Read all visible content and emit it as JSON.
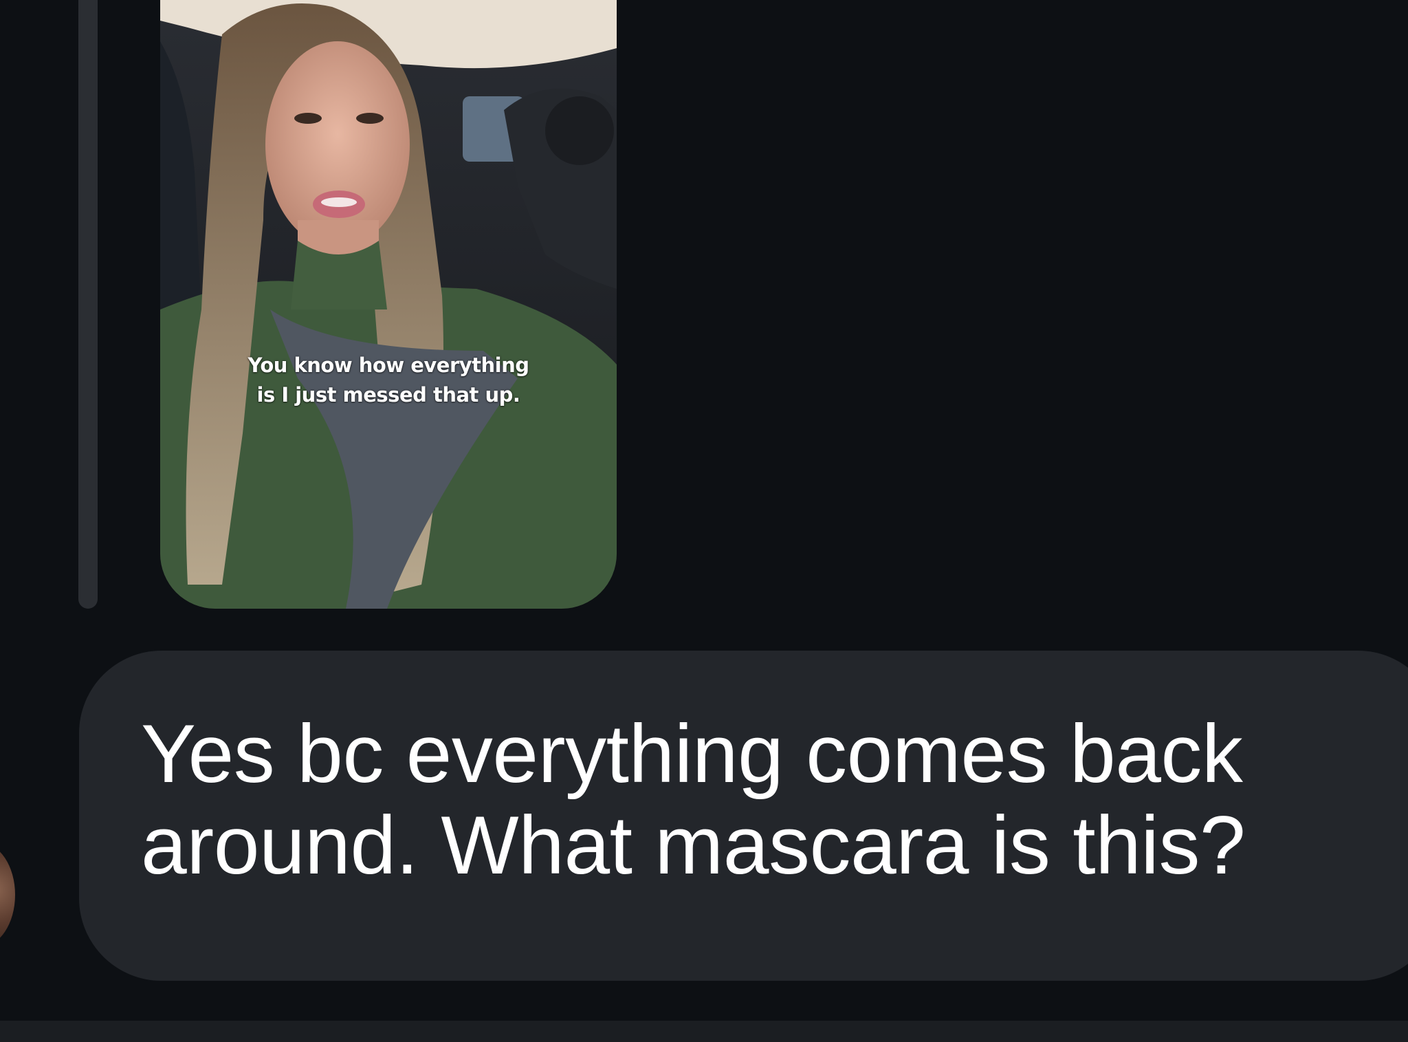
{
  "story_reply": {
    "caption_line_1": "You know how everything",
    "caption_line_2": "is I just messed that up."
  },
  "message": {
    "text": "Yes bc everything comes back around. What mascara is this?"
  },
  "colors": {
    "background": "#0d1014",
    "bubble": "#23262b",
    "reply_bar": "#2b2e33",
    "text": "#ffffff"
  }
}
